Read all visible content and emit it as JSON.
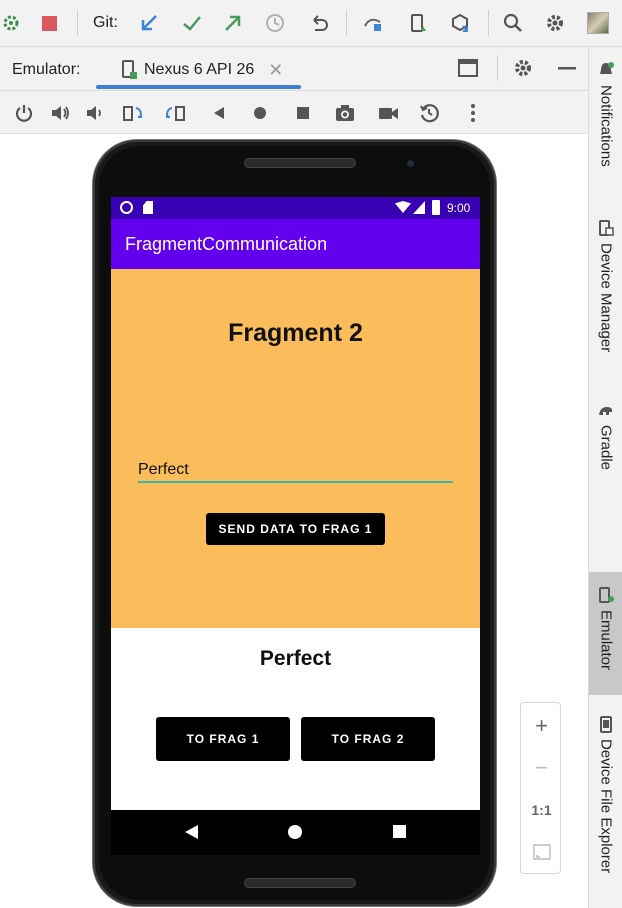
{
  "toolbar": {
    "git_label": "Git:",
    "icons": [
      "build-icon",
      "stop-icon",
      "git-update-icon",
      "git-commit-icon",
      "git-push-icon",
      "history-icon",
      "rollback-icon",
      "device-mirror-icon",
      "device-manager-icon",
      "sdk-manager-icon",
      "search-icon",
      "settings-icon",
      "avatar"
    ]
  },
  "emulator_bar": {
    "label": "Emulator:",
    "tab_label": "Nexus 6 API 26",
    "close": "✕"
  },
  "right_sidebar": {
    "items": [
      {
        "label": "Notifications"
      },
      {
        "label": "Device Manager"
      },
      {
        "label": "Gradle"
      },
      {
        "label": "Emulator"
      },
      {
        "label": "Device File Explorer"
      }
    ]
  },
  "device": {
    "status_time": "9:00",
    "app_title": "FragmentCommunication",
    "fragment2": {
      "title": "Fragment 2",
      "input_value": "Perfect",
      "send_button": "SEND DATA TO FRAG 1"
    },
    "fragment1": {
      "received_text": "Perfect"
    },
    "buttons": {
      "to_frag1": "TO FRAG 1",
      "to_frag2": "TO FRAG 2"
    }
  },
  "zoom": {
    "zoom_in": "+",
    "zoom_out": "−",
    "one_to_one": "1:1"
  },
  "colors": {
    "status_bar": "#3700b3",
    "app_bar": "#6200ee",
    "fragment2_bg": "#fbbd5c",
    "underline": "#38b8a2",
    "tab_accent": "#3d7fd6"
  }
}
